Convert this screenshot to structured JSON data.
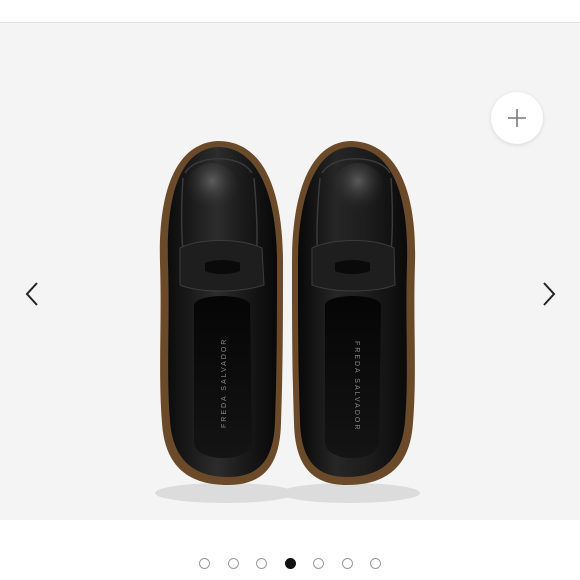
{
  "gallery": {
    "zoom_icon": "plus-icon",
    "prev_icon": "chevron-left-icon",
    "next_icon": "chevron-right-icon",
    "image": {
      "subject": "black leather penny loafers top view",
      "insole_brand_left": "FREDA SALVADOR",
      "insole_brand_right": "FREDA SALVADOR"
    },
    "pagination": {
      "total": 7,
      "active_index": 3
    },
    "colors": {
      "stage_background": "#f4f4f4",
      "active_dot": "#111111",
      "inactive_dot_border": "#9a9a9a"
    }
  }
}
